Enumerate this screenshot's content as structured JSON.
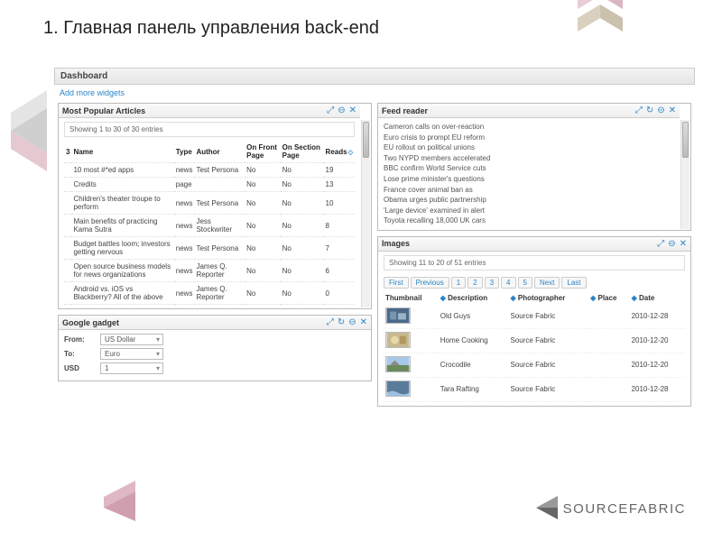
{
  "title_num": "1.",
  "title_text": "Главная панель управления back-end",
  "dashboard_header": "Dashboard",
  "add_widgets": "Add more widgets",
  "widget_popular": {
    "title": "Most Popular Articles",
    "showing": "Showing 1 to 30 of 30 entries",
    "cols": {
      "num": "3",
      "name": "Name",
      "type": "Type",
      "author": "Author",
      "front": "On Front Page",
      "section": "On Section Page",
      "reads": "Reads"
    },
    "rows": [
      {
        "name": "10 most #*ed apps",
        "type": "news",
        "author": "Test Persona",
        "front": "No",
        "section": "No",
        "reads": "19"
      },
      {
        "name": "Credits",
        "type": "page",
        "author": "",
        "front": "No",
        "section": "No",
        "reads": "13"
      },
      {
        "name": "Children's theater troupe to perform",
        "type": "news",
        "author": "Test Persona",
        "front": "No",
        "section": "No",
        "reads": "10"
      },
      {
        "name": "Main benefits of practicing Kama Sutra",
        "type": "news",
        "author": "Jess Stockwriter",
        "front": "No",
        "section": "No",
        "reads": "8"
      },
      {
        "name": "Budget battles loom; investors getting nervous",
        "type": "news",
        "author": "Test Persona",
        "front": "No",
        "section": "No",
        "reads": "7"
      },
      {
        "name": "Open source business models for news organizations",
        "type": "news",
        "author": "James Q. Reporter",
        "front": "No",
        "section": "No",
        "reads": "6"
      },
      {
        "name": "Android vs. iOS vs Blackberry? All of the above",
        "type": "news",
        "author": "James Q. Reporter",
        "front": "No",
        "section": "No",
        "reads": "0"
      }
    ]
  },
  "widget_google": {
    "title": "Google gadget",
    "from_lbl": "From:",
    "from_val": "US Dollar",
    "to_lbl": "To:",
    "to_val": "Euro",
    "usd_lbl": "USD",
    "usd_val": "1"
  },
  "widget_feed": {
    "title": "Feed reader",
    "items": [
      "Cameron calls on over-reaction",
      "Euro crisis to prompt EU reform",
      "EU rollout on political unions",
      "Two NYPD members accelerated",
      "BBC confirm World Service cuts",
      "Lose prime minister's questions",
      "France cover animal ban as",
      "Obama urges public partnership",
      "'Large device' examined in alert",
      "Toyota recalling 18,000 UK cars"
    ]
  },
  "widget_images": {
    "title": "Images",
    "showing": "Showing 11 to 20 of 51 entries",
    "pager": {
      "first": "First",
      "prev": "Previous",
      "p1": "1",
      "p2": "2",
      "p3": "3",
      "p4": "4",
      "p5": "5",
      "next": "Next",
      "last": "Last"
    },
    "cols": {
      "thumb": "Thumbnail",
      "desc": "Description",
      "photog": "Photographer",
      "place": "Place",
      "date": "Date"
    },
    "rows": [
      {
        "desc": "Old Guys",
        "photog": "Source Fabric",
        "place": "",
        "date": "2010-12-28"
      },
      {
        "desc": "Home Cooking",
        "photog": "Source Fabric",
        "place": "",
        "date": "2010-12-20"
      },
      {
        "desc": "Crocodile",
        "photog": "Source Fabric",
        "place": "",
        "date": "2010-12-20"
      },
      {
        "desc": "Tara Rafting",
        "photog": "Source Fabric",
        "place": "",
        "date": "2010-12-28"
      }
    ]
  },
  "brand": "SOURCEFABRIC"
}
